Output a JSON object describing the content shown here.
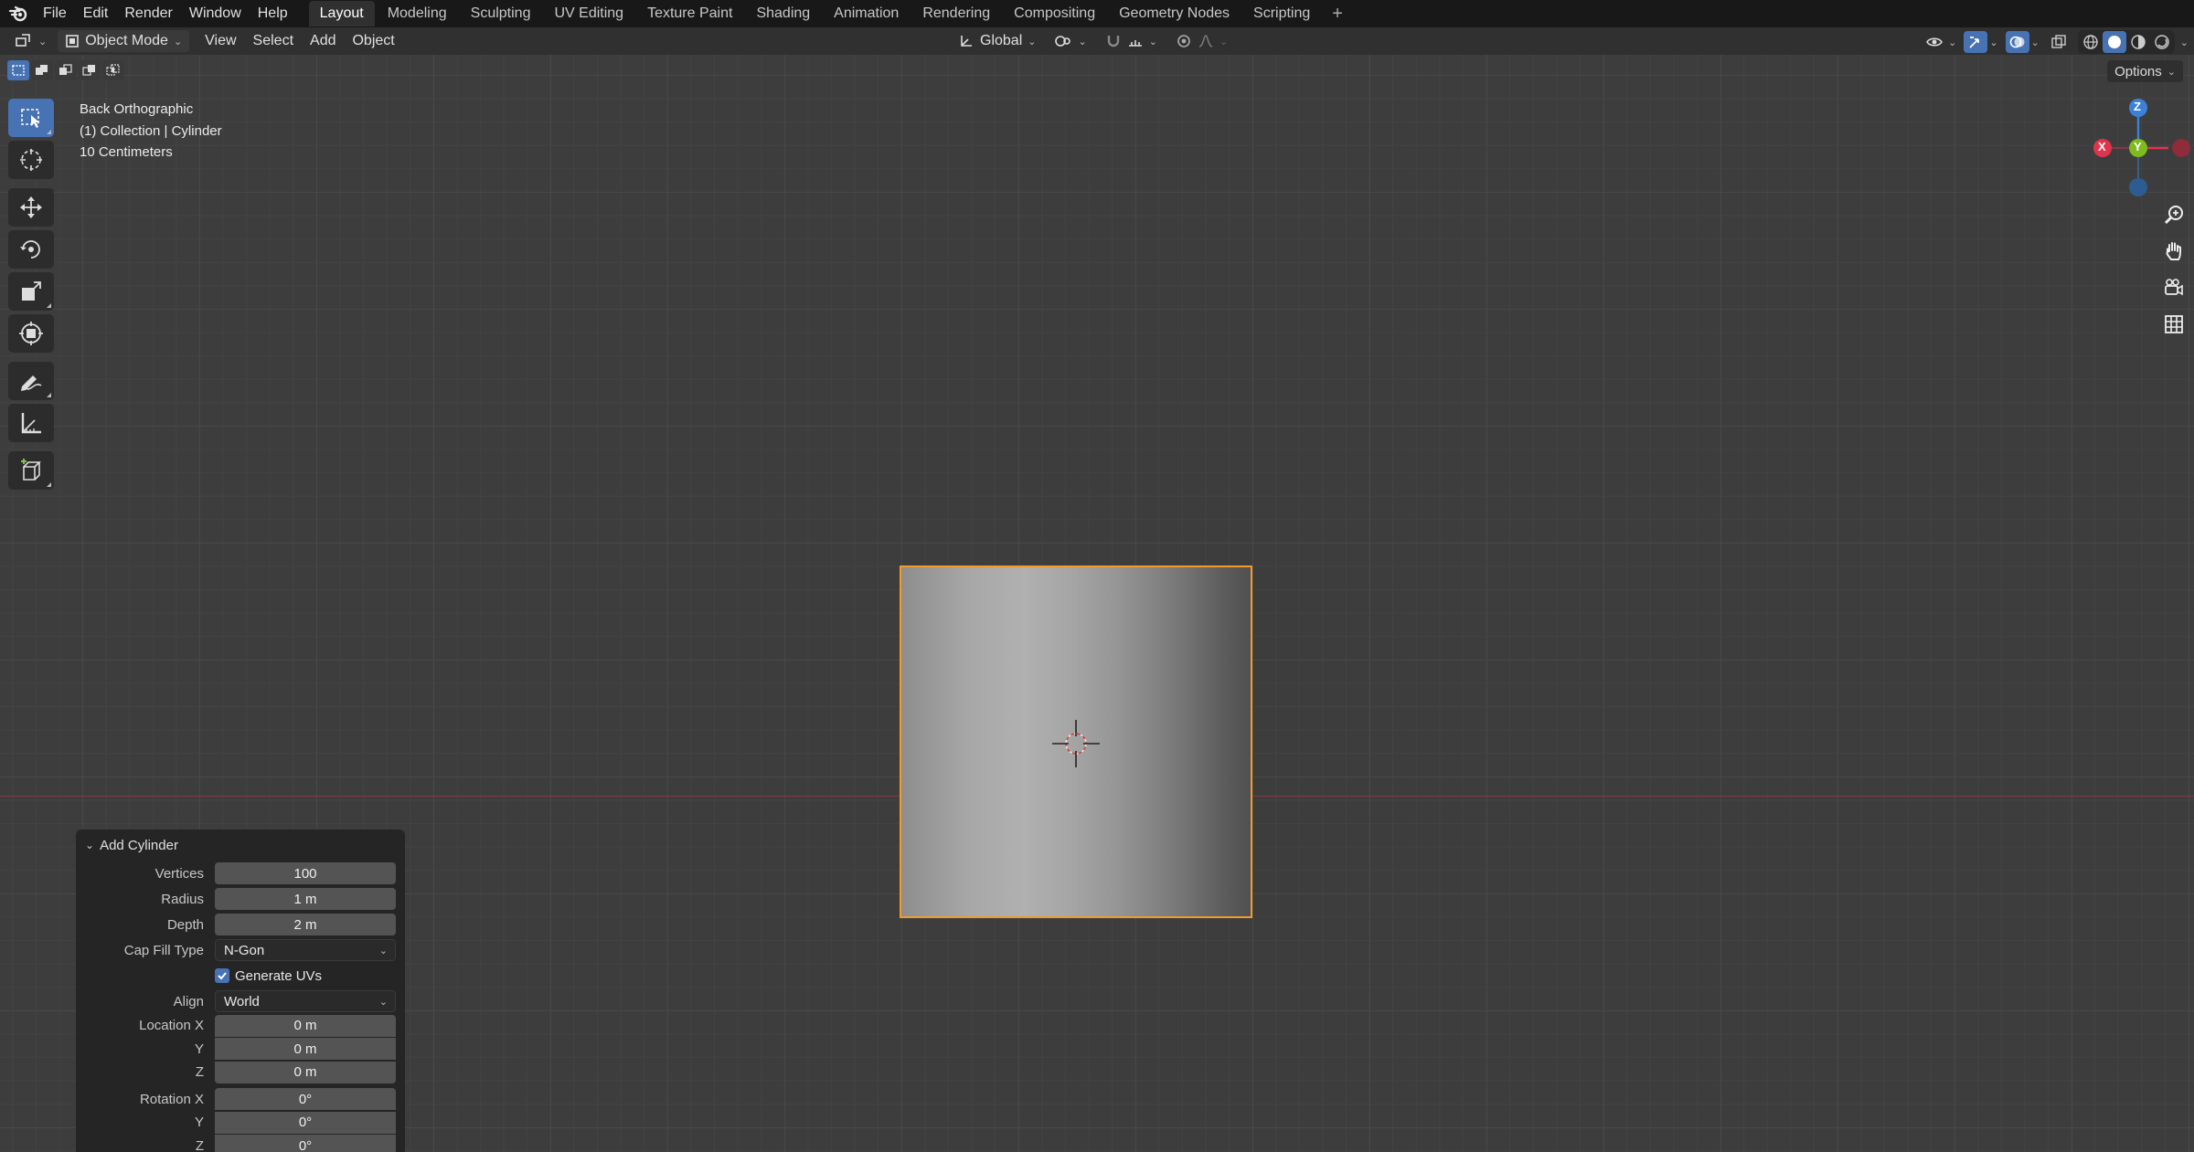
{
  "menu": {
    "items": [
      "File",
      "Edit",
      "Render",
      "Window",
      "Help"
    ]
  },
  "workspaces": {
    "tabs": [
      "Layout",
      "Modeling",
      "Sculpting",
      "UV Editing",
      "Texture Paint",
      "Shading",
      "Animation",
      "Rendering",
      "Compositing",
      "Geometry Nodes",
      "Scripting"
    ],
    "active": "Layout",
    "add_label": "+"
  },
  "header": {
    "mode": "Object Mode",
    "menus": [
      "View",
      "Select",
      "Add",
      "Object"
    ],
    "transform_orientation": "Global",
    "options_label": "Options"
  },
  "viewport": {
    "view_name": "Back Orthographic",
    "collection": "(1) Collection | Cylinder",
    "scale": "10 Centimeters"
  },
  "gizmo": {
    "z": "Z",
    "y": "Y",
    "x": "X",
    "colors": {
      "x": "#e0344c",
      "y": "#7dbb1e",
      "z": "#3b82d6"
    }
  },
  "operator_panel": {
    "title": "Add Cylinder",
    "vertices_label": "Vertices",
    "vertices_value": "100",
    "radius_label": "Radius",
    "radius_value": "1 m",
    "depth_label": "Depth",
    "depth_value": "2 m",
    "cap_fill_label": "Cap Fill Type",
    "cap_fill_value": "N-Gon",
    "generate_uvs_label": "Generate UVs",
    "generate_uvs_checked": true,
    "align_label": "Align",
    "align_value": "World",
    "location_x_label": "Location X",
    "location_x": "0 m",
    "location_y_label": "Y",
    "location_y": "0 m",
    "location_z_label": "Z",
    "location_z": "0 m",
    "rotation_x_label": "Rotation X",
    "rotation_x": "0°",
    "rotation_y_label": "Y",
    "rotation_y": "0°",
    "rotation_z_label": "Z",
    "rotation_z": "0°"
  },
  "colors": {
    "accent": "#4772b3",
    "selection_outline": "#f29b2a"
  }
}
